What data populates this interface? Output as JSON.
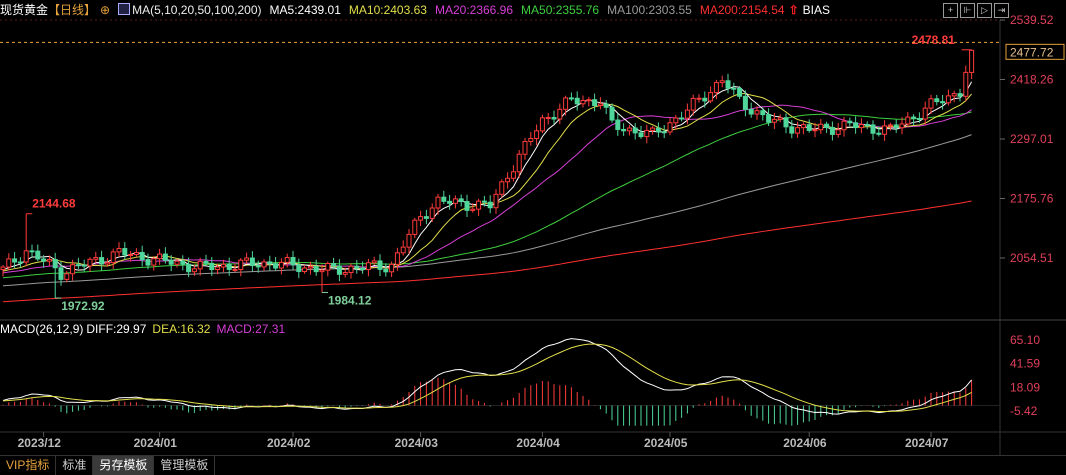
{
  "header": {
    "instrument": "现货黄金",
    "period": "【日线】",
    "ma_label": "MA(5,10,20,50,100,200)",
    "ma5": "MA5:2439.01",
    "ma10": "MA10:2403.63",
    "ma20": "MA20:2366.96",
    "ma50": "MA50:2355.76",
    "ma100": "MA100:2303.55",
    "ma200": "MA200:2154.54",
    "bias": "BIAS",
    "tools": [
      "crosshair",
      "zoom-in",
      "play",
      "exit"
    ]
  },
  "colors": {
    "up": "#ff3b3b",
    "down": "#4fd69a",
    "ma5": "#ffffff",
    "ma10": "#e3df4a",
    "ma20": "#d63fd6",
    "ma50": "#3fcf3f",
    "ma100": "#9a9a9a",
    "ma200": "#ff3030",
    "axis": "#e0405a",
    "grid": "#5a1a1a"
  },
  "macd_header": {
    "label": "MACD(26,12,9)",
    "diff": "DIFF:29.97",
    "dea": "DEA:16.32",
    "macd": "MACD:27.31"
  },
  "tabs": [
    "VIP指标",
    "标准",
    "另存模板",
    "管理模板"
  ],
  "active_tab": 2,
  "chart_data": [
    {
      "type": "candlestick",
      "title": "现货黄金 日线",
      "n_candles": 168,
      "close_anchors": [
        [
          0,
          2030
        ],
        [
          4,
          2070
        ],
        [
          10,
          2025
        ],
        [
          20,
          2065
        ],
        [
          34,
          2035
        ],
        [
          46,
          2045
        ],
        [
          56,
          2030
        ],
        [
          67,
          2040
        ],
        [
          72,
          2140
        ],
        [
          75,
          2170
        ],
        [
          84,
          2160
        ],
        [
          87,
          2225
        ],
        [
          93,
          2335
        ],
        [
          98,
          2375
        ],
        [
          103,
          2375
        ],
        [
          105,
          2325
        ],
        [
          112,
          2305
        ],
        [
          118,
          2355
        ],
        [
          124,
          2418
        ],
        [
          127,
          2375
        ],
        [
          132,
          2335
        ],
        [
          139,
          2315
        ],
        [
          146,
          2325
        ],
        [
          153,
          2315
        ],
        [
          160,
          2365
        ],
        [
          165,
          2395
        ],
        [
          167,
          2477.72
        ]
      ],
      "warmup_anchors": [
        [
          0,
          1900
        ],
        [
          200,
          2030
        ]
      ],
      "annotations": [
        {
          "index": 4,
          "type": "high",
          "value": "2144.68"
        },
        {
          "index": 9,
          "type": "low",
          "value": "1972.92"
        },
        {
          "index": 55,
          "type": "low",
          "value": "1984.12"
        },
        {
          "index": 167,
          "type": "high",
          "value": "2478.81"
        }
      ],
      "last_price": "2477.72",
      "y_ticks": [
        "2539.52",
        "2418.26",
        "2297.01",
        "2175.76",
        "2054.51"
      ],
      "ylim": [
        1900,
        2539.52
      ],
      "x_ticks": [
        {
          "index": 7,
          "label": "2023/12"
        },
        {
          "index": 27,
          "label": "2024/01"
        },
        {
          "index": 50,
          "label": "2024/02"
        },
        {
          "index": 72,
          "label": "2024/03"
        },
        {
          "index": 93,
          "label": "2024/04"
        },
        {
          "index": 115,
          "label": "2024/05"
        },
        {
          "index": 139,
          "label": "2024/06"
        },
        {
          "index": 160,
          "label": "2024/07"
        }
      ],
      "series": [
        "MA5",
        "MA10",
        "MA20",
        "MA50",
        "MA100",
        "MA200"
      ]
    },
    {
      "type": "bar+line",
      "title": "MACD(26,12,9)",
      "y_ticks": [
        "65.10",
        "41.59",
        "18.09",
        "-5.42"
      ],
      "ylim": [
        -20,
        70
      ],
      "series": [
        "DIFF",
        "DEA",
        "MACD"
      ]
    }
  ]
}
